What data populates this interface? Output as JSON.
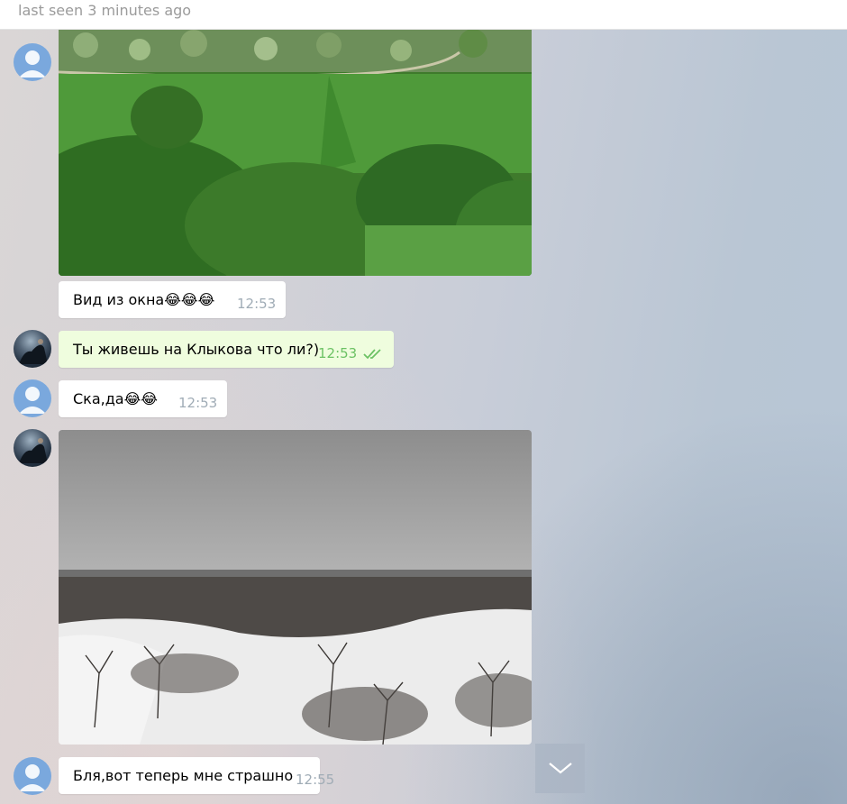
{
  "header": {
    "status": "last seen 3 minutes ago"
  },
  "messages": [
    {
      "id": "photo1",
      "type": "photo",
      "photo_icon": "green-landscape-photo"
    },
    {
      "id": "m1",
      "type": "text",
      "text": "Вид из окна😂😂😂",
      "time": "12:53",
      "direction": "in"
    },
    {
      "id": "m2",
      "type": "text",
      "text": "Ты живешь на Клыкова что ли?)",
      "time": "12:53",
      "direction": "out",
      "read": "double-check-icon"
    },
    {
      "id": "m3",
      "type": "text",
      "text": "Ска,да😂😂",
      "time": "12:53",
      "direction": "in"
    },
    {
      "id": "photo2",
      "type": "photo",
      "photo_icon": "snowy-landscape-photo"
    },
    {
      "id": "m4",
      "type": "text",
      "text": "Бля,вот теперь мне страшно",
      "time": "12:55",
      "direction": "in"
    }
  ],
  "scroll_button": {
    "icon": "chevron-down-icon"
  },
  "colors": {
    "incoming_bubble": "#ffffff",
    "outgoing_bubble": "#effdde",
    "read_check": "#6cc264",
    "avatar_default": "#7aa8dd"
  }
}
